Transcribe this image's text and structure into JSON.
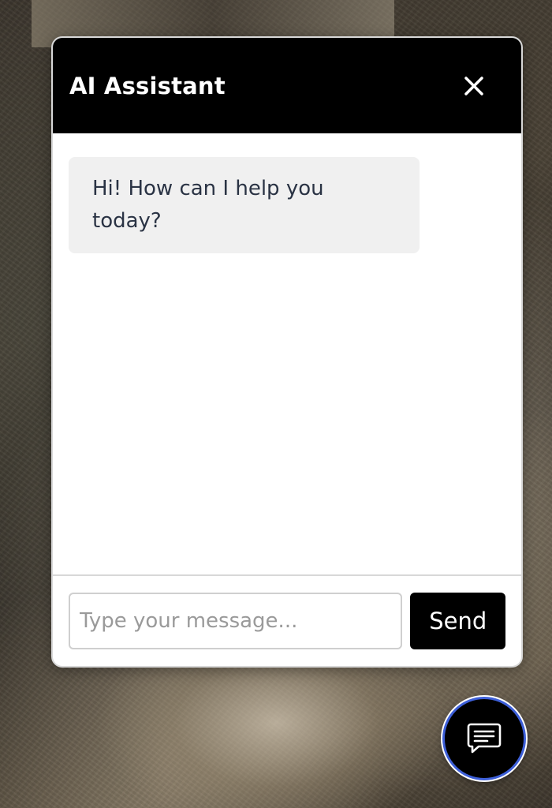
{
  "chat": {
    "title": "AI Assistant",
    "messages": [
      {
        "role": "assistant",
        "text": "Hi! How can I help you today?"
      }
    ],
    "input": {
      "value": "",
      "placeholder": "Type your message..."
    },
    "send_label": "Send"
  },
  "icons": {
    "close": "close-icon",
    "chat_toggle": "chat-bubble-icon"
  },
  "colors": {
    "header_bg": "#000000",
    "bubble_bg": "#f0f0f0",
    "fab_ring": "#3d5fd8"
  }
}
